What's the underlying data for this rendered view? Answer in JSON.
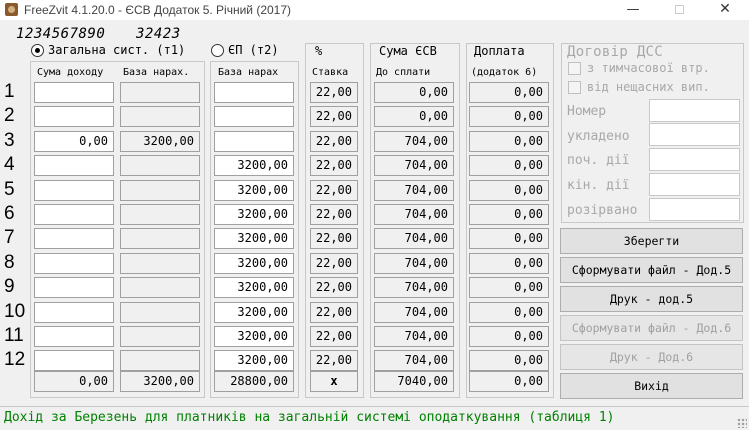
{
  "window": {
    "title": "FreeZvit 4.1.20.0 - ЄСВ Додаток 5. Річний (2017)",
    "minimize": "—",
    "close": "✕"
  },
  "header": {
    "code": "1234567890",
    "number": "32423"
  },
  "radios": {
    "general": "Загальна сист. (т1)",
    "ep": "ЄП (т2)",
    "selected": "general"
  },
  "columns": {
    "income_sum": "Сума доходу",
    "base_accrual": "База нарах.",
    "ep_base": "База нарах",
    "percent": "%",
    "rate": "Ставка",
    "esv_sum": "Сума ЄСВ",
    "to_pay": "До сплати",
    "surcharge": "Доплата",
    "surcharge_sub": "(додаток 6)"
  },
  "rows": [
    {
      "n": "1",
      "income": "",
      "base": "",
      "ep_base": "",
      "rate": "22,00",
      "esv": "0,00",
      "extra": "0,00"
    },
    {
      "n": "2",
      "income": "",
      "base": "",
      "ep_base": "",
      "rate": "22,00",
      "esv": "0,00",
      "extra": "0,00"
    },
    {
      "n": "3",
      "income": "0,00",
      "base": "3200,00",
      "ep_base": "",
      "rate": "22,00",
      "esv": "704,00",
      "extra": "0,00"
    },
    {
      "n": "4",
      "income": "",
      "base": "",
      "ep_base": "3200,00",
      "rate": "22,00",
      "esv": "704,00",
      "extra": "0,00"
    },
    {
      "n": "5",
      "income": "",
      "base": "",
      "ep_base": "3200,00",
      "rate": "22,00",
      "esv": "704,00",
      "extra": "0,00"
    },
    {
      "n": "6",
      "income": "",
      "base": "",
      "ep_base": "3200,00",
      "rate": "22,00",
      "esv": "704,00",
      "extra": "0,00"
    },
    {
      "n": "7",
      "income": "",
      "base": "",
      "ep_base": "3200,00",
      "rate": "22,00",
      "esv": "704,00",
      "extra": "0,00"
    },
    {
      "n": "8",
      "income": "",
      "base": "",
      "ep_base": "3200,00",
      "rate": "22,00",
      "esv": "704,00",
      "extra": "0,00"
    },
    {
      "n": "9",
      "income": "",
      "base": "",
      "ep_base": "3200,00",
      "rate": "22,00",
      "esv": "704,00",
      "extra": "0,00"
    },
    {
      "n": "10",
      "income": "",
      "base": "",
      "ep_base": "3200,00",
      "rate": "22,00",
      "esv": "704,00",
      "extra": "0,00"
    },
    {
      "n": "11",
      "income": "",
      "base": "",
      "ep_base": "3200,00",
      "rate": "22,00",
      "esv": "704,00",
      "extra": "0,00"
    },
    {
      "n": "12",
      "income": "",
      "base": "",
      "ep_base": "3200,00",
      "rate": "22,00",
      "esv": "704,00",
      "extra": "0,00"
    }
  ],
  "totals": {
    "income": "0,00",
    "base": "3200,00",
    "ep_base": "28800,00",
    "rate": "x",
    "esv": "7040,00",
    "extra": "0,00"
  },
  "dss": {
    "title": "Договір ДСС",
    "temp_disability": "з тимчасової втр.",
    "accident": "від нещасних вип.",
    "number_label": "Номер",
    "concluded_label": "укладено",
    "start_label": "поч. дії",
    "end_label": "кін. дії",
    "terminated_label": "розірвано"
  },
  "buttons": {
    "save": "Зберегти",
    "make_file_5": "Сформувати файл - Дод.5",
    "print_5": "Друк - дод.5",
    "make_file_6": "Сформувати файл - Дод.6",
    "print_6": "Друк - Дод.6",
    "exit": "Вихід"
  },
  "status": "Дохід за Березень для платників на загальній системі оподаткування (таблиця 1)",
  "colors": {
    "status_text": "#008000",
    "disabled_text": "#a8a8a8"
  }
}
